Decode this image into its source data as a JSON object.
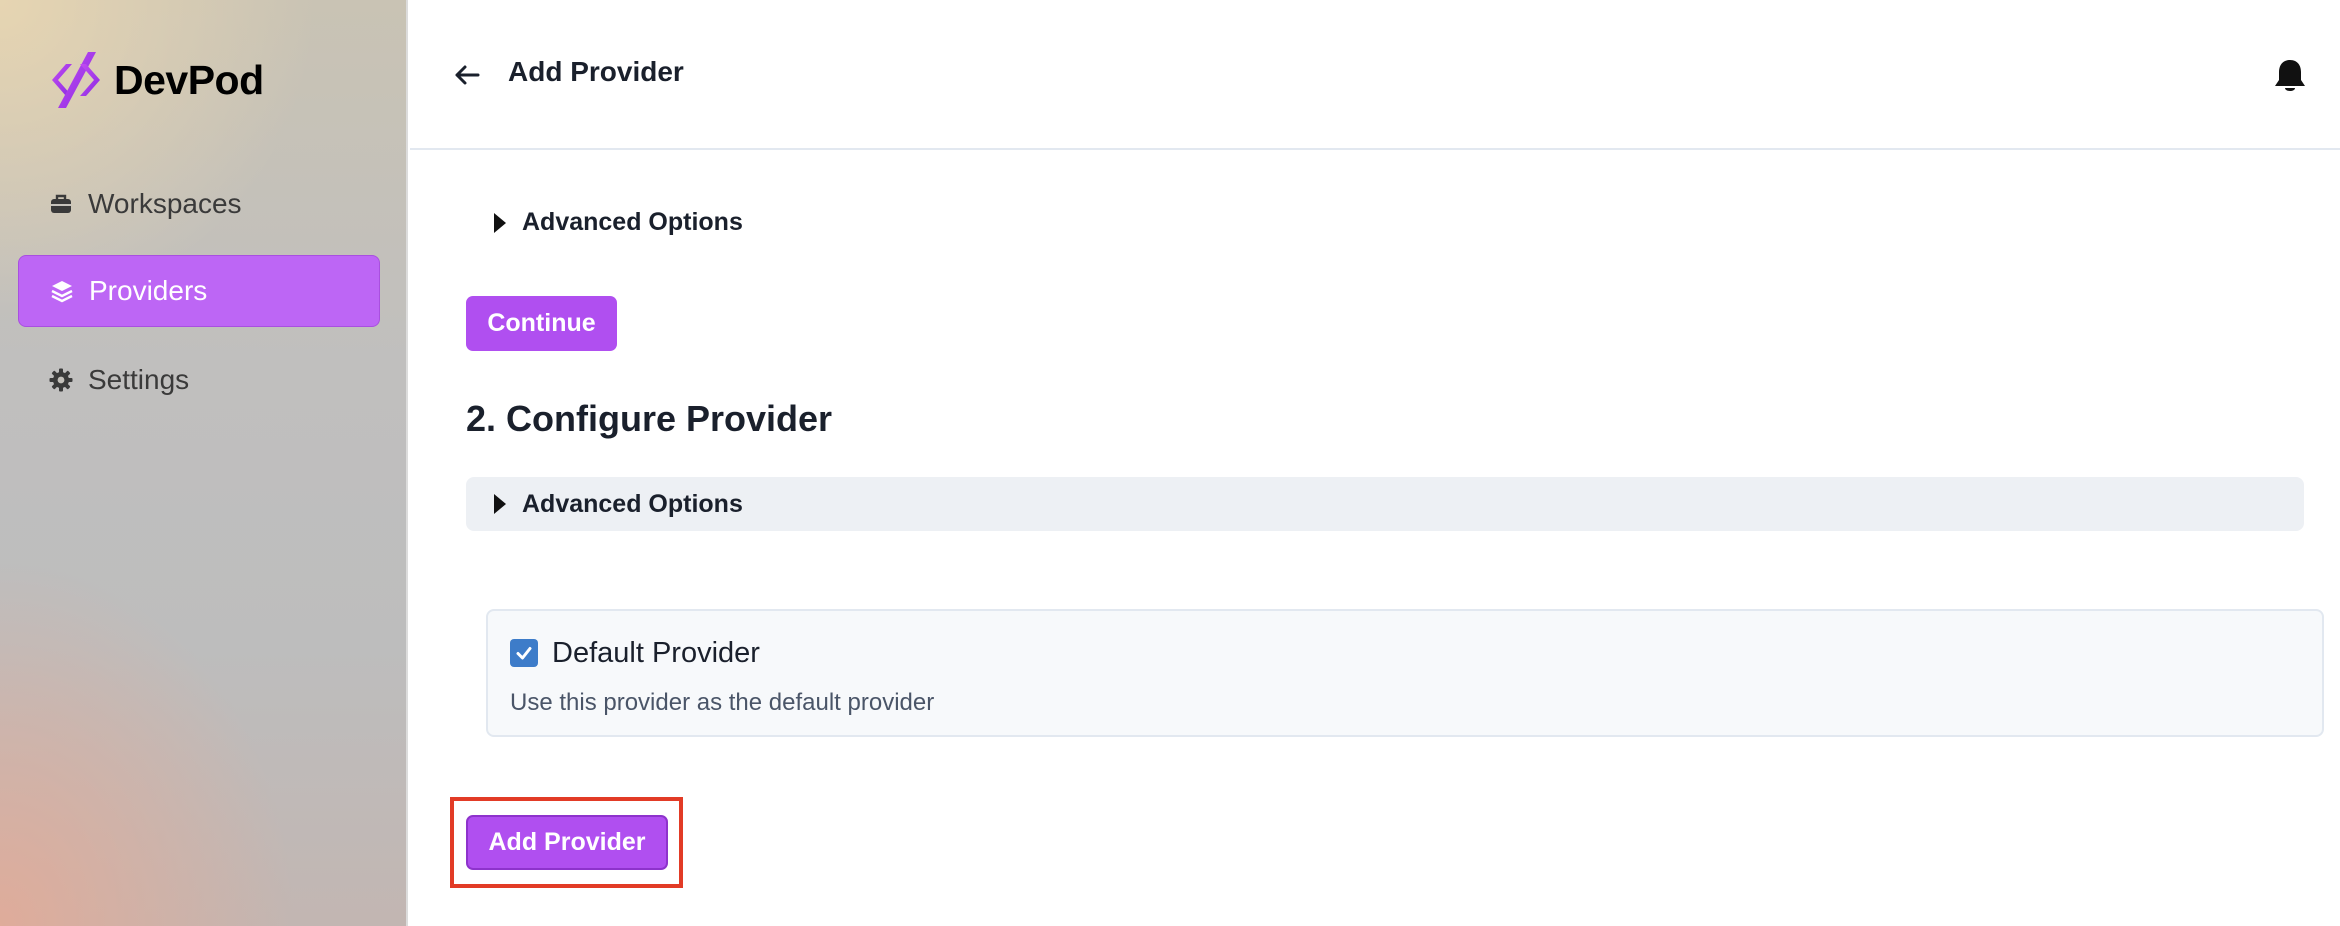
{
  "app": {
    "brand": "DevPod"
  },
  "sidebar": {
    "items": [
      {
        "label": "Workspaces",
        "icon": "briefcase-icon",
        "active": false
      },
      {
        "label": "Providers",
        "icon": "layers-icon",
        "active": true
      },
      {
        "label": "Settings",
        "icon": "gear-icon",
        "active": false
      }
    ]
  },
  "header": {
    "title": "Add Provider",
    "back_icon": "back-arrow-icon",
    "notification_icon": "bell-icon"
  },
  "main": {
    "advanced_options_1": "Advanced Options",
    "continue_label": "Continue",
    "section_title": "2. Configure Provider",
    "advanced_options_2": "Advanced Options",
    "default_provider": {
      "label": "Default Provider",
      "checked": true,
      "help": "Use this provider as the default provider"
    },
    "add_provider_label": "Add Provider"
  },
  "colors": {
    "accent": "#b04ff0",
    "active_nav": "#bd66f5",
    "checkbox": "#3d7cc9",
    "highlight": "#e23b26"
  }
}
